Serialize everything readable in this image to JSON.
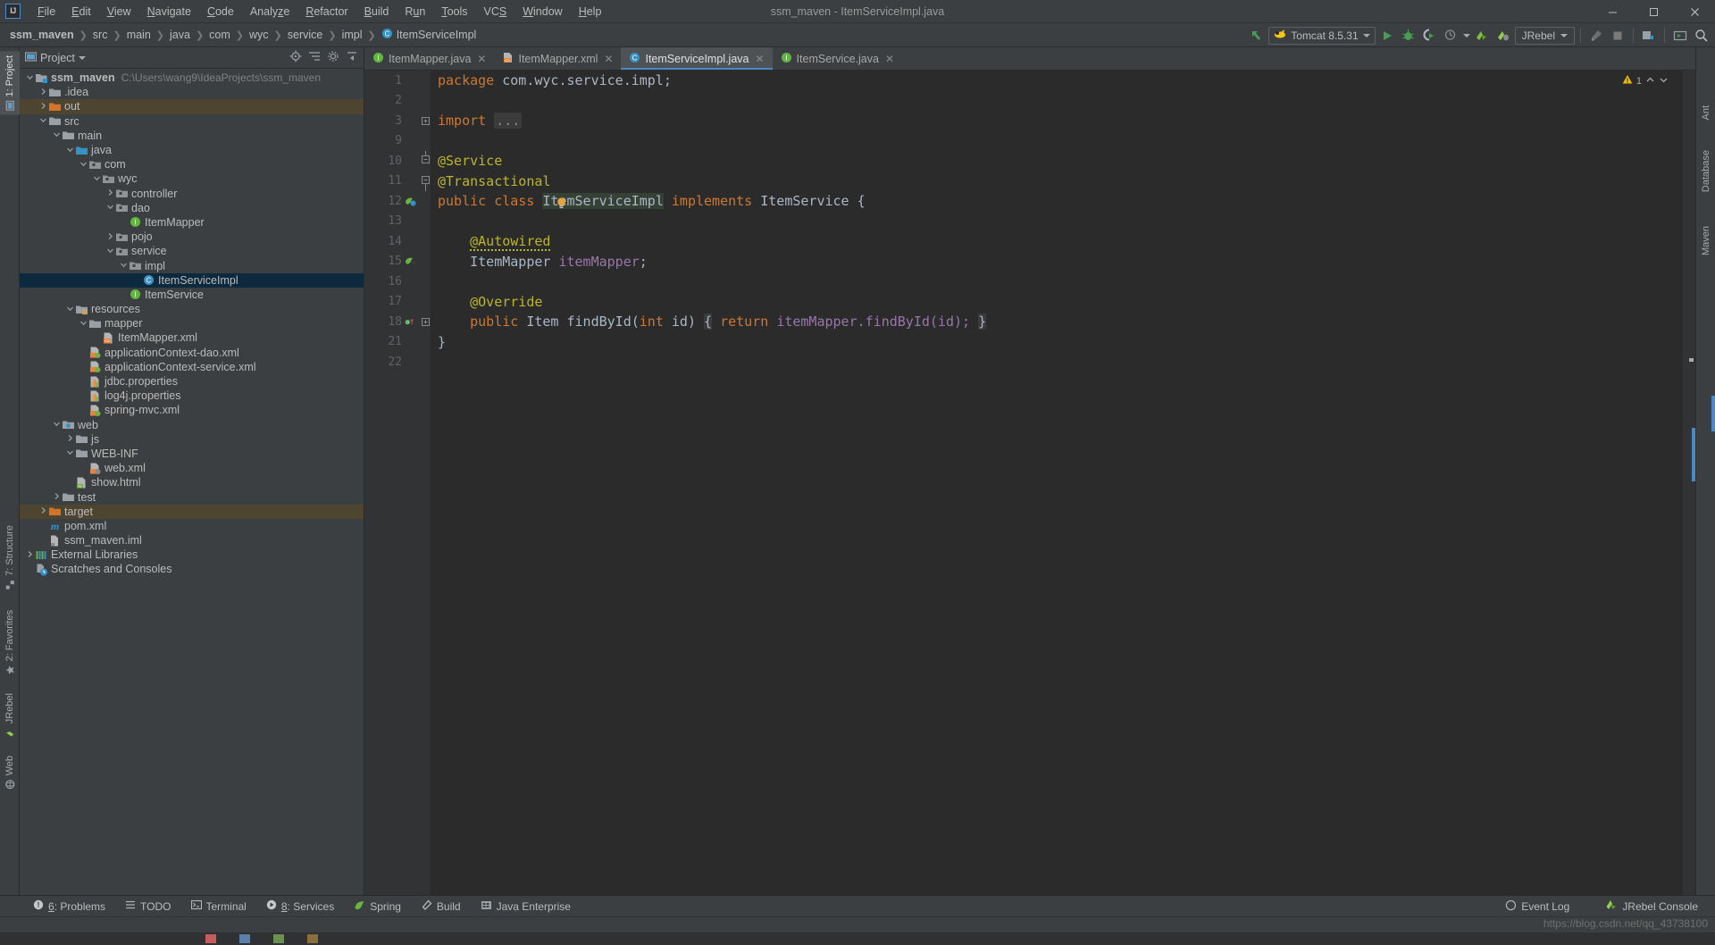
{
  "window": {
    "title": "ssm_maven - ItemServiceImpl.java",
    "logo": "IJ",
    "minimize": "—",
    "maximize": "❐",
    "close": "✕"
  },
  "menu": {
    "items": [
      {
        "label": "File",
        "mnemonic": "F"
      },
      {
        "label": "Edit",
        "mnemonic": "E"
      },
      {
        "label": "View",
        "mnemonic": "V"
      },
      {
        "label": "Navigate",
        "mnemonic": "N"
      },
      {
        "label": "Code",
        "mnemonic": "C"
      },
      {
        "label": "Analyze",
        "mnemonic": "z"
      },
      {
        "label": "Refactor",
        "mnemonic": "R"
      },
      {
        "label": "Build",
        "mnemonic": "B"
      },
      {
        "label": "Run",
        "mnemonic": "u"
      },
      {
        "label": "Tools",
        "mnemonic": "T"
      },
      {
        "label": "VCS",
        "mnemonic": "S"
      },
      {
        "label": "Window",
        "mnemonic": "W"
      },
      {
        "label": "Help",
        "mnemonic": "H"
      }
    ]
  },
  "breadcrumb": {
    "items": [
      "ssm_maven",
      "src",
      "main",
      "java",
      "com",
      "wyc",
      "service",
      "impl",
      "ItemServiceImpl"
    ],
    "separator": "›",
    "last_icon": "class-icon"
  },
  "toolbar": {
    "back_icon": "arrow-up-left-icon",
    "run_config": {
      "label": "Tomcat 8.5.31",
      "icon": "tomcat-icon",
      "dropdown": "▾"
    },
    "run_icon": "run-icon",
    "debug_icon": "debug-icon",
    "coverage_icon": "coverage-icon",
    "profile_icon": "profile-icon",
    "jrebel_run_icon": "jrebel-run-icon",
    "jrebel_debug_icon": "jrebel-debug-icon",
    "jrebel_config": {
      "label": "JRebel",
      "dropdown": "▾"
    },
    "build_icon": "hammer-icon",
    "stop_icon": "stop-icon",
    "project_structure_icon": "project-structure-icon",
    "layout_icon": "layout-icon",
    "search_icon": "search-icon"
  },
  "left_strip": {
    "tabs": [
      {
        "label": "1: Project",
        "icon": "project-icon",
        "active": true
      },
      {
        "label": "7: Structure",
        "icon": "structure-icon",
        "active": false
      },
      {
        "label": "2: Favorites",
        "icon": "star-icon",
        "active": false
      },
      {
        "label": "JRebel",
        "icon": "jrebel-icon",
        "active": false
      },
      {
        "label": "Web",
        "icon": "web-icon",
        "active": false
      }
    ]
  },
  "right_strip": {
    "tabs": [
      {
        "label": "Ant",
        "icon": "ant-icon"
      },
      {
        "label": "Database",
        "icon": "database-icon"
      },
      {
        "label": "Maven",
        "icon": "maven-icon"
      }
    ]
  },
  "project_panel": {
    "title": "Project",
    "title_dropdown": "▾",
    "icon": "project-panel-icon",
    "actions": [
      "target-icon",
      "collapse-all-icon",
      "settings-icon",
      "hide-icon"
    ],
    "tree": [
      {
        "indent": 0,
        "arrow": "down",
        "icon": "module-icon",
        "label": "ssm_maven",
        "bold": true,
        "path": "C:\\Users\\wang9\\IdeaProjects\\ssm_maven",
        "state": "none"
      },
      {
        "indent": 1,
        "arrow": "right",
        "icon": "folder-icon",
        "label": ".idea",
        "state": "none"
      },
      {
        "indent": 1,
        "arrow": "right",
        "icon": "folder-orange-icon",
        "label": "out",
        "state": "highlight"
      },
      {
        "indent": 1,
        "arrow": "down",
        "icon": "folder-icon",
        "label": "src",
        "state": "none"
      },
      {
        "indent": 2,
        "arrow": "down",
        "icon": "folder-icon",
        "label": "main",
        "state": "none"
      },
      {
        "indent": 3,
        "arrow": "down",
        "icon": "folder-blue-icon",
        "label": "java",
        "state": "none"
      },
      {
        "indent": 4,
        "arrow": "down",
        "icon": "package-icon",
        "label": "com",
        "state": "none"
      },
      {
        "indent": 5,
        "arrow": "down",
        "icon": "package-icon",
        "label": "wyc",
        "state": "none"
      },
      {
        "indent": 6,
        "arrow": "right",
        "icon": "package-icon",
        "label": "controller",
        "state": "none"
      },
      {
        "indent": 6,
        "arrow": "down",
        "icon": "package-icon",
        "label": "dao",
        "state": "none"
      },
      {
        "indent": 7,
        "arrow": "none",
        "icon": "interface-icon",
        "label": "ItemMapper",
        "state": "none"
      },
      {
        "indent": 6,
        "arrow": "right",
        "icon": "package-icon",
        "label": "pojo",
        "state": "none"
      },
      {
        "indent": 6,
        "arrow": "down",
        "icon": "package-icon",
        "label": "service",
        "state": "none"
      },
      {
        "indent": 7,
        "arrow": "down",
        "icon": "package-icon",
        "label": "impl",
        "state": "none"
      },
      {
        "indent": 8,
        "arrow": "none",
        "icon": "class-icon",
        "label": "ItemServiceImpl",
        "state": "selected"
      },
      {
        "indent": 7,
        "arrow": "none",
        "icon": "interface-icon",
        "label": "ItemService",
        "state": "none"
      },
      {
        "indent": 3,
        "arrow": "down",
        "icon": "resources-icon",
        "label": "resources",
        "state": "none"
      },
      {
        "indent": 4,
        "arrow": "down",
        "icon": "folder-icon",
        "label": "mapper",
        "state": "none"
      },
      {
        "indent": 5,
        "arrow": "none",
        "icon": "xml-icon",
        "label": "ItemMapper.xml",
        "state": "none"
      },
      {
        "indent": 4,
        "arrow": "none",
        "icon": "xml-spring-icon",
        "label": "applicationContext-dao.xml",
        "state": "none"
      },
      {
        "indent": 4,
        "arrow": "none",
        "icon": "xml-spring-icon",
        "label": "applicationContext-service.xml",
        "state": "none"
      },
      {
        "indent": 4,
        "arrow": "none",
        "icon": "properties-icon",
        "label": "jdbc.properties",
        "state": "none"
      },
      {
        "indent": 4,
        "arrow": "none",
        "icon": "properties-icon",
        "label": "log4j.properties",
        "state": "none"
      },
      {
        "indent": 4,
        "arrow": "none",
        "icon": "xml-spring-icon",
        "label": "spring-mvc.xml",
        "state": "none"
      },
      {
        "indent": 2,
        "arrow": "down",
        "icon": "web-folder-icon",
        "label": "web",
        "state": "none"
      },
      {
        "indent": 3,
        "arrow": "right",
        "icon": "folder-icon",
        "label": "js",
        "state": "none"
      },
      {
        "indent": 3,
        "arrow": "down",
        "icon": "folder-icon",
        "label": "WEB-INF",
        "state": "none"
      },
      {
        "indent": 4,
        "arrow": "none",
        "icon": "xml-web-icon",
        "label": "web.xml",
        "state": "none"
      },
      {
        "indent": 3,
        "arrow": "none",
        "icon": "html-icon",
        "label": "show.html",
        "state": "none"
      },
      {
        "indent": 2,
        "arrow": "right",
        "icon": "folder-icon",
        "label": "test",
        "state": "none"
      },
      {
        "indent": 1,
        "arrow": "right",
        "icon": "folder-orange-icon",
        "label": "target",
        "state": "highlight"
      },
      {
        "indent": 1,
        "arrow": "none",
        "icon": "maven-pom-icon",
        "label": "pom.xml",
        "state": "none"
      },
      {
        "indent": 1,
        "arrow": "none",
        "icon": "iml-icon",
        "label": "ssm_maven.iml",
        "state": "none"
      },
      {
        "indent": 0,
        "arrow": "right",
        "icon": "libraries-icon",
        "label": "External Libraries",
        "state": "none"
      },
      {
        "indent": 0,
        "arrow": "none",
        "icon": "scratches-icon",
        "label": "Scratches and Consoles",
        "state": "none"
      }
    ]
  },
  "editor": {
    "tabs": [
      {
        "label": "ItemMapper.java",
        "icon": "interface-icon",
        "active": false,
        "close": "✕"
      },
      {
        "label": "ItemMapper.xml",
        "icon": "xml-icon",
        "active": false,
        "close": "✕"
      },
      {
        "label": "ItemServiceImpl.java",
        "icon": "class-icon",
        "active": true,
        "close": "✕"
      },
      {
        "label": "ItemService.java",
        "icon": "interface-icon",
        "active": false,
        "close": "✕"
      }
    ],
    "inspection": {
      "warning_count": "1",
      "warning_icon": "warning-triangle-icon",
      "up": "⌃",
      "down": "⌄"
    },
    "lines": [
      {
        "num": "1",
        "fold": "none",
        "marker": "none"
      },
      {
        "num": "2",
        "fold": "none",
        "marker": "none"
      },
      {
        "num": "3",
        "fold": "plus",
        "marker": "none"
      },
      {
        "num": "9",
        "fold": "none",
        "marker": "none"
      },
      {
        "num": "10",
        "fold": "end",
        "marker": "none"
      },
      {
        "num": "11",
        "fold": "start",
        "marker": "none"
      },
      {
        "num": "12",
        "fold": "none",
        "marker": "bean-icon"
      },
      {
        "num": "13",
        "fold": "none",
        "marker": "none"
      },
      {
        "num": "14",
        "fold": "none",
        "marker": "none"
      },
      {
        "num": "15",
        "fold": "none",
        "marker": "autowired-icon"
      },
      {
        "num": "16",
        "fold": "none",
        "marker": "none"
      },
      {
        "num": "17",
        "fold": "none",
        "marker": "none"
      },
      {
        "num": "18",
        "fold": "plus",
        "marker": "override-icon"
      },
      {
        "num": "21",
        "fold": "none",
        "marker": "none"
      },
      {
        "num": "22",
        "fold": "none",
        "marker": "none"
      }
    ],
    "code_text": {
      "l1_kw": "package",
      "l1_rest": " com.wyc.service.impl;",
      "l3_kw": "import",
      "l3_fold": "...",
      "l10": "@Service",
      "l11": "@Transactional",
      "l12_a": "public class ",
      "l12_name": "ItemServiceImpl",
      "l12_b": " implements ",
      "l12_iface": "ItemService",
      "l12_c": " {",
      "l14": "@Autowired",
      "l15_type": "ItemMapper",
      "l15_field": " itemMapper",
      "l15_semi": ";",
      "l17": "@Override",
      "l18_a": "public ",
      "l18_type": "Item",
      "l18_m": " findById(",
      "l18_int": "int",
      "l18_param": " id) ",
      "l18_brace": "{",
      "l18_ret": " return ",
      "l18_tail": "itemMapper.findById(id); ",
      "l18_close": "}",
      "l21": "}"
    },
    "lightbulb_icon": "intention-bulb-icon"
  },
  "statusbar": {
    "left_items": [
      {
        "label": "6: Problems",
        "icon": "problems-icon",
        "mnemonic": "6"
      },
      {
        "label": "TODO",
        "icon": "todo-icon",
        "mnemonic": ""
      },
      {
        "label": "Terminal",
        "icon": "terminal-icon",
        "mnemonic": ""
      },
      {
        "label": "8: Services",
        "icon": "services-icon",
        "mnemonic": "8"
      },
      {
        "label": "Spring",
        "icon": "spring-icon",
        "mnemonic": ""
      },
      {
        "label": "Build",
        "icon": "build-hammer-icon",
        "mnemonic": ""
      },
      {
        "label": "Java Enterprise",
        "icon": "java-enterprise-icon",
        "mnemonic": ""
      }
    ],
    "right_items": [
      {
        "label": "Event Log",
        "icon": "event-log-icon"
      },
      {
        "label": "JRebel Console",
        "icon": "jrebel-console-icon"
      }
    ]
  },
  "watermark": "https://blog.csdn.net/qq_43738100"
}
